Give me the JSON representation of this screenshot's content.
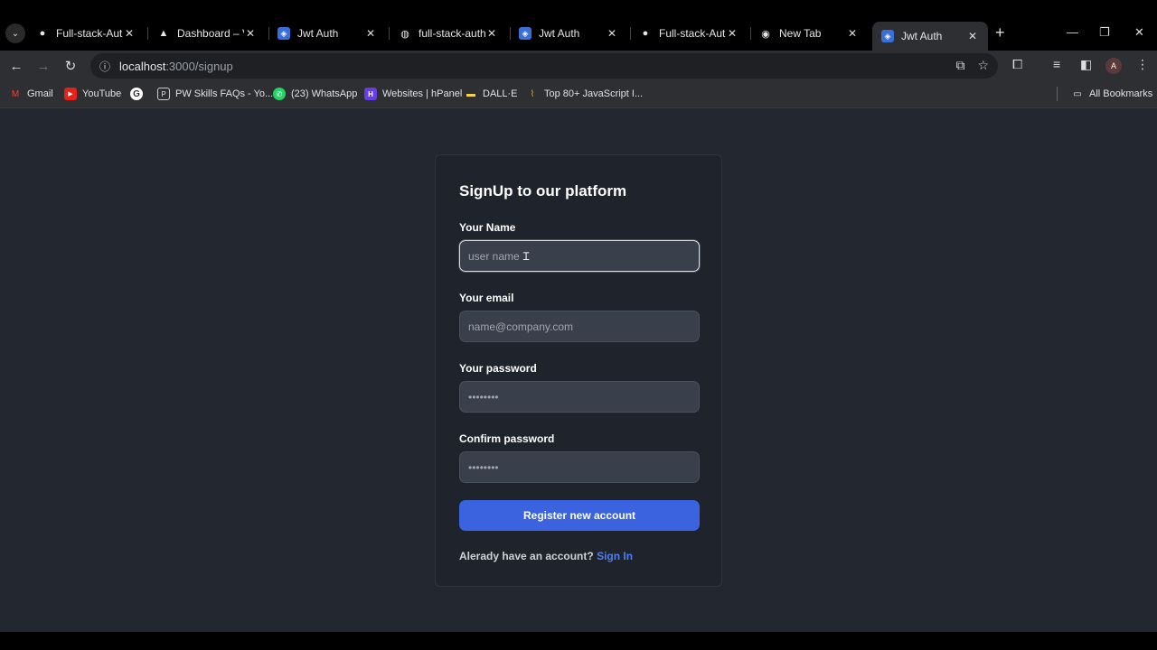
{
  "tabs": [
    {
      "title": "Full-stack-Authi",
      "icon": "github-icon"
    },
    {
      "title": "Dashboard – Ver",
      "icon": "vercel-icon"
    },
    {
      "title": "Jwt Auth",
      "icon": "shield-icon"
    },
    {
      "title": "full-stack-authi",
      "icon": "globe-icon"
    },
    {
      "title": "Jwt Auth",
      "icon": "shield-icon"
    },
    {
      "title": "Full-stack-Authi",
      "icon": "github-icon"
    },
    {
      "title": "New Tab",
      "icon": "chrome-icon"
    },
    {
      "title": "Jwt Auth",
      "icon": "shield-icon",
      "active": true
    }
  ],
  "address": {
    "host": "localhost",
    "path": ":3000/signup"
  },
  "bookmarks": [
    {
      "label": "Gmail"
    },
    {
      "label": "YouTube"
    },
    {
      "label": ""
    },
    {
      "label": "PW Skills FAQs - Yo..."
    },
    {
      "label": "(23) WhatsApp"
    },
    {
      "label": "Websites | hPanel"
    },
    {
      "label": "DALL·E"
    },
    {
      "label": "Top 80+ JavaScript I..."
    }
  ],
  "all_bookmarks": "All Bookmarks",
  "profile_initial": "A",
  "form": {
    "title": "SignUp to our platform",
    "name_label": "Your Name",
    "name_placeholder": "user name",
    "email_label": "Your email",
    "email_placeholder": "name@company.com",
    "password_label": "Your password",
    "password_value": "••••••••",
    "confirm_label": "Confirm password",
    "confirm_value": "••••••••",
    "register_label": "Register new account",
    "already_text": "Alerady have an account? ",
    "signin_label": "Sign In"
  },
  "colors": {
    "accent": "#3b63e0",
    "link": "#4f7ef0",
    "page_bg": "#23272f",
    "card_bg": "#1e232c"
  }
}
